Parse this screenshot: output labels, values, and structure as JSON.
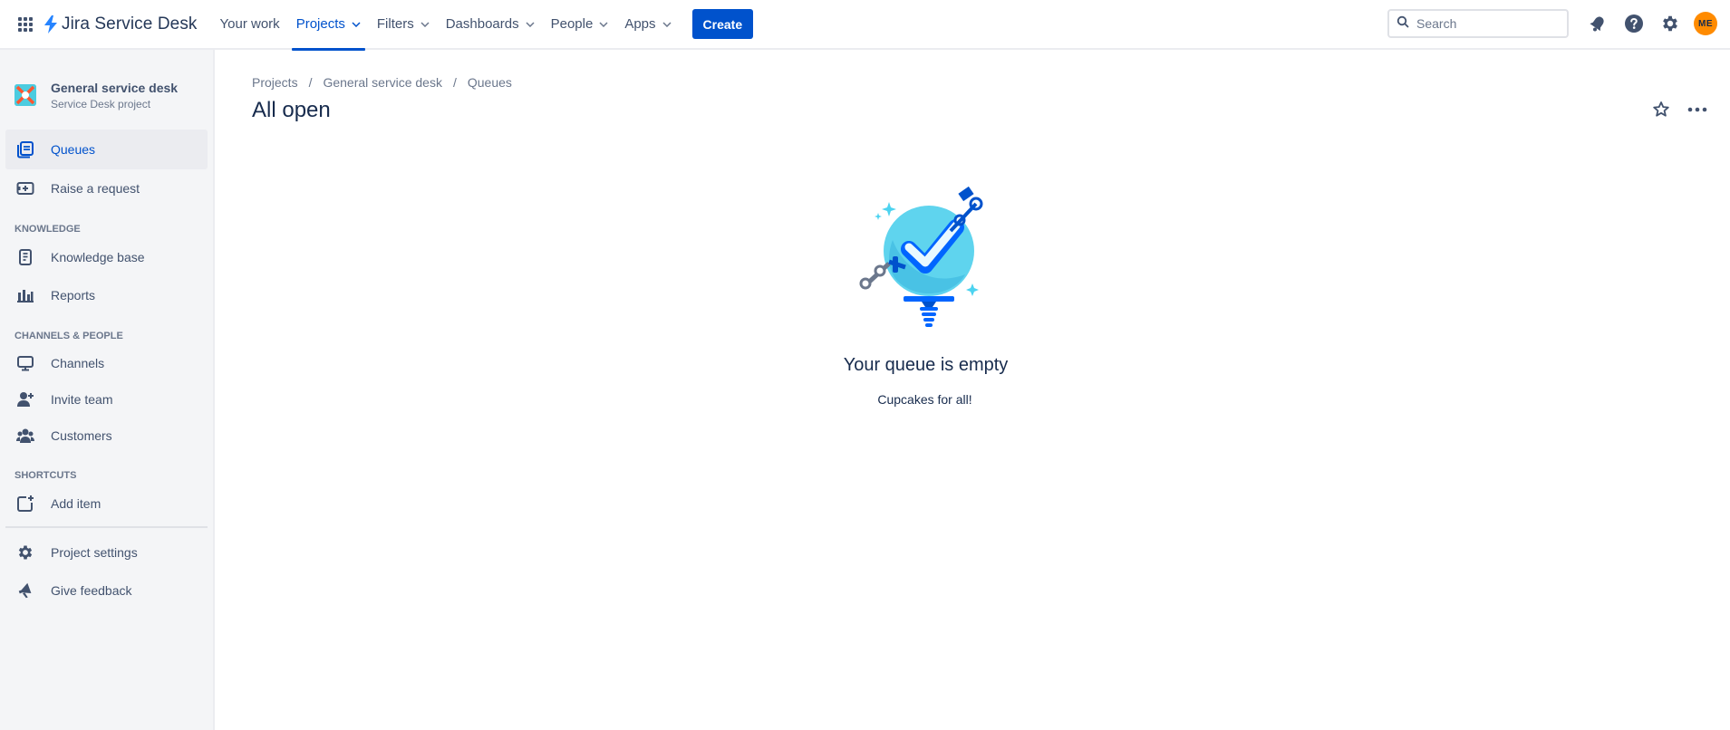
{
  "topnav": {
    "logo_text": "Jira Service Desk",
    "items": [
      {
        "label": "Your work",
        "has_menu": false
      },
      {
        "label": "Projects",
        "has_menu": true
      },
      {
        "label": "Filters",
        "has_menu": true
      },
      {
        "label": "Dashboards",
        "has_menu": true
      },
      {
        "label": "People",
        "has_menu": true
      },
      {
        "label": "Apps",
        "has_menu": true
      }
    ],
    "active_item": "Projects",
    "create_label": "Create",
    "search_placeholder": "Search",
    "avatar_initials": "ME",
    "colors": {
      "accent": "#0052cc",
      "avatar": "#ff8b00"
    }
  },
  "sidebar": {
    "project_name": "General service desk",
    "project_type": "Service Desk project",
    "items": [
      {
        "label": "Queues",
        "icon": "queues-icon",
        "selected": true
      },
      {
        "label": "Raise a request",
        "icon": "raise-request-icon"
      }
    ],
    "knowledge_heading": "KNOWLEDGE",
    "knowledge_items": [
      {
        "label": "Knowledge base",
        "icon": "book-icon"
      },
      {
        "label": "Reports",
        "icon": "bar-chart-icon"
      }
    ],
    "channels_heading": "CHANNELS & PEOPLE",
    "channels_items": [
      {
        "label": "Channels",
        "icon": "monitor-icon"
      },
      {
        "label": "Invite team",
        "icon": "invite-person-icon"
      },
      {
        "label": "Customers",
        "icon": "people-icon"
      }
    ],
    "shortcuts_heading": "SHORTCUTS",
    "shortcuts_items": [
      {
        "label": "Add item",
        "icon": "add-item-icon"
      }
    ],
    "footer_items": [
      {
        "label": "Project settings",
        "icon": "gear-icon"
      },
      {
        "label": "Give feedback",
        "icon": "megaphone-icon"
      }
    ]
  },
  "main": {
    "breadcrumbs": [
      "Projects",
      "General service desk",
      "Queues"
    ],
    "title": "All open",
    "empty_title": "Your queue is empty",
    "empty_subtitle": "Cupcakes for all!"
  }
}
